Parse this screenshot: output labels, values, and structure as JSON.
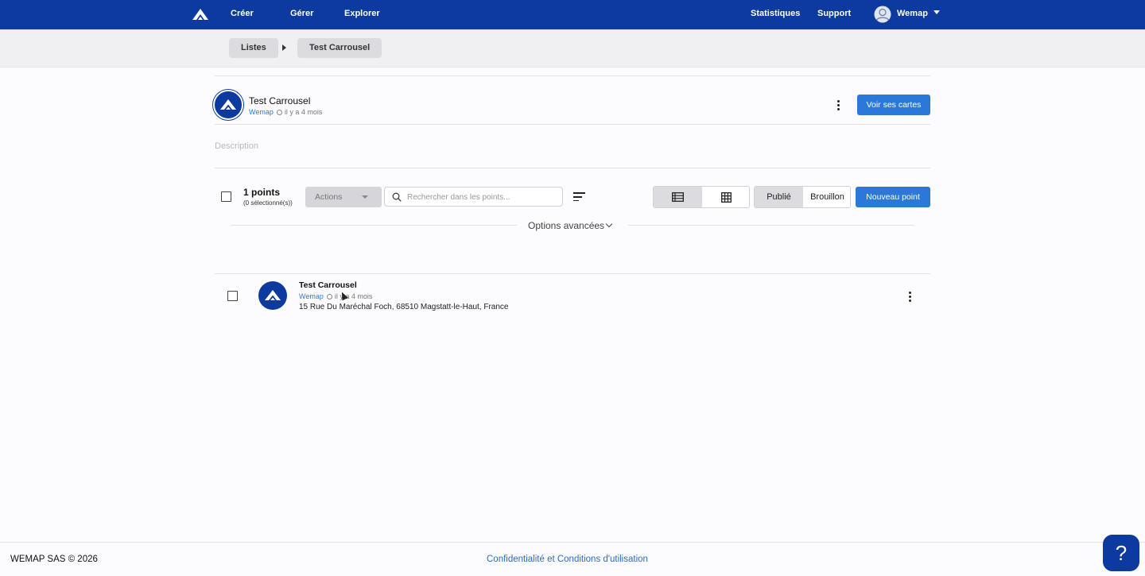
{
  "nav": {
    "logo": "wemap-logo-icon",
    "links": [
      "Créer",
      "Gérer",
      "Explorer"
    ],
    "right_links": [
      "Statistiques",
      "Support"
    ],
    "user_name": "Wemap"
  },
  "breadcrumb": {
    "items": [
      "Listes",
      "Test Carrousel"
    ]
  },
  "list": {
    "title": "Test Carrousel",
    "author": "Wemap",
    "time": "il y a 4 mois",
    "view_maps_label": "Voir ses cartes",
    "description_placeholder": "Description"
  },
  "toolbar": {
    "points_count": "1 points",
    "selected_count": "(0 sélectionné(s))",
    "actions_label": "Actions",
    "search_placeholder": "Rechercher dans les points...",
    "view_modes": [
      "list-view-icon",
      "grid-view-icon"
    ],
    "status_published": "Publié",
    "status_draft": "Brouillon",
    "new_point_label": "Nouveau point",
    "advanced_options": "Options avancées"
  },
  "points": [
    {
      "title": "Test Carrousel",
      "author": "Wemap",
      "time": "il y a 4 mois",
      "address": "15 Rue Du Maréchal Foch, 68510 Magstatt-le-Haut, France"
    }
  ],
  "footer": {
    "copyright": "WEMAP SAS © 2026",
    "legal_link": "Confidentialité et Conditions d'utilisation",
    "help_label": "?"
  },
  "colors": {
    "brand": "#0d3a9e",
    "primary_button": "#2b78d8",
    "link": "#2b6cc4"
  }
}
